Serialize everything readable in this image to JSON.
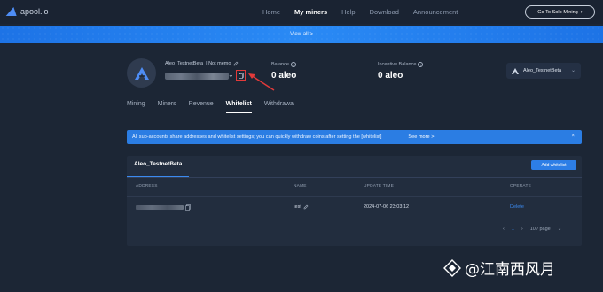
{
  "header": {
    "logo_text": "apool.io",
    "nav": [
      "Home",
      "My miners",
      "Help",
      "Download",
      "Announcement"
    ],
    "active_nav": "My miners",
    "solo_button": "Go To Solo Mining"
  },
  "banner": {
    "text": "View all >"
  },
  "account": {
    "name": "Aleo_TestnetBeta",
    "memo": "| Not memo",
    "balance_label": "Balance",
    "balance_value": "0 aleo",
    "incentive_label": "Incentive Balance",
    "incentive_value": "0 aleo",
    "coin_select": "Aleo_TestnetBeta"
  },
  "tabs": [
    "Mining",
    "Miners",
    "Revenue",
    "Whitelist",
    "Withdrawal"
  ],
  "active_tab": "Whitelist",
  "info": {
    "text": "All sub-accounts share addresses and whitelist settings; you can quickly withdraw coins after setting the [whitelist]",
    "link": "See more >",
    "close": "×"
  },
  "panel": {
    "tab": "Aleo_TestnetBeta",
    "add_button": "Add whitelist",
    "columns": [
      "ADDRESS",
      "NAME",
      "UPDATE TIME",
      "OPERATE"
    ],
    "rows": [
      {
        "name": "test",
        "update_time": "2024-07-06 23:03:12",
        "operate": "Delete"
      }
    ],
    "pager": {
      "prev": "‹",
      "page": "1",
      "next": "›",
      "size": "10 / page"
    }
  },
  "watermark": {
    "text": "@江南西风月"
  },
  "colors": {
    "accent": "#2b7de3",
    "highlight": "#e23a3a",
    "background": "#1c2635"
  },
  "icons": [
    "logo-icon",
    "edit-icon",
    "chevron-down-icon",
    "copy-icon",
    "info-icon",
    "close-icon"
  ]
}
